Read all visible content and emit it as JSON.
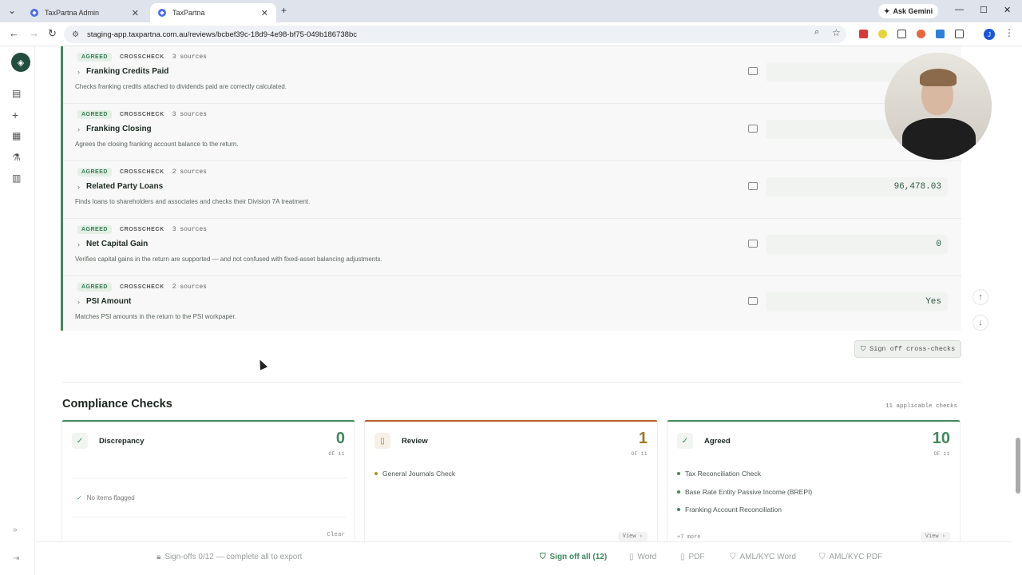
{
  "browser": {
    "tabs": [
      {
        "title": "TaxPartna Admin",
        "active": false
      },
      {
        "title": "TaxPartna",
        "active": true
      }
    ],
    "gemini_label": "Ask Gemini",
    "url": "staging-app.taxpartna.com.au/reviews/bcbef39c-18d9-4e98-bf75-049b186738bc",
    "profile_initial": "J"
  },
  "crosschecks": {
    "rows": [
      {
        "status": "AGREED",
        "type": "CROSSCHECK",
        "sources": "3 sources",
        "name": "Franking Credits Paid",
        "description": "Checks franking credits attached to dividends paid are correctly calculated.",
        "value": ""
      },
      {
        "status": "AGREED",
        "type": "CROSSCHECK",
        "sources": "3 sources",
        "name": "Franking Closing",
        "description": "Agrees the closing franking account balance to the return.",
        "value": ""
      },
      {
        "status": "AGREED",
        "type": "CROSSCHECK",
        "sources": "2 sources",
        "name": "Related Party Loans",
        "description": "Finds loans to shareholders and associates and checks their Division 7A treatment.",
        "value": "96,478.03"
      },
      {
        "status": "AGREED",
        "type": "CROSSCHECK",
        "sources": "3 sources",
        "name": "Net Capital Gain",
        "description": "Verifies capital gains in the return are supported — and not confused with fixed-asset balancing adjustments.",
        "value": "0"
      },
      {
        "status": "AGREED",
        "type": "CROSSCHECK",
        "sources": "2 sources",
        "name": "PSI Amount",
        "description": "Matches PSI amounts in the return to the PSI workpaper.",
        "value": "Yes"
      }
    ],
    "signoff_label": "Sign off cross-checks"
  },
  "compliance": {
    "title": "Compliance Checks",
    "count_label": "11 applicable checks",
    "cards": [
      {
        "title": "Discrepancy",
        "count": "0",
        "of": "OF 11",
        "empty_text": "No items flagged",
        "action": "Clear"
      },
      {
        "title": "Review",
        "count": "1",
        "of": "OF 11",
        "items": [
          "General Journals Check"
        ],
        "action": "View ›"
      },
      {
        "title": "Agreed",
        "count": "10",
        "of": "OF 11",
        "items": [
          "Tax Reconciliation Check",
          "Base Rate Entity Passive Income (BREPI)",
          "Franking Account Reconciliation"
        ],
        "more": "+7 more",
        "action": "View ›"
      }
    ]
  },
  "footer": {
    "signoffs": "Sign-offs 0/12 — complete all to export",
    "signoff_all": "Sign off all (12)",
    "word": "Word",
    "pdf": "PDF",
    "aml_word": "AML/KYC Word",
    "aml_pdf": "AML/KYC PDF"
  },
  "colors": {
    "accent_green": "#3f8a5c",
    "review_amber": "#9a7a24",
    "review_border": "#b4652a"
  }
}
